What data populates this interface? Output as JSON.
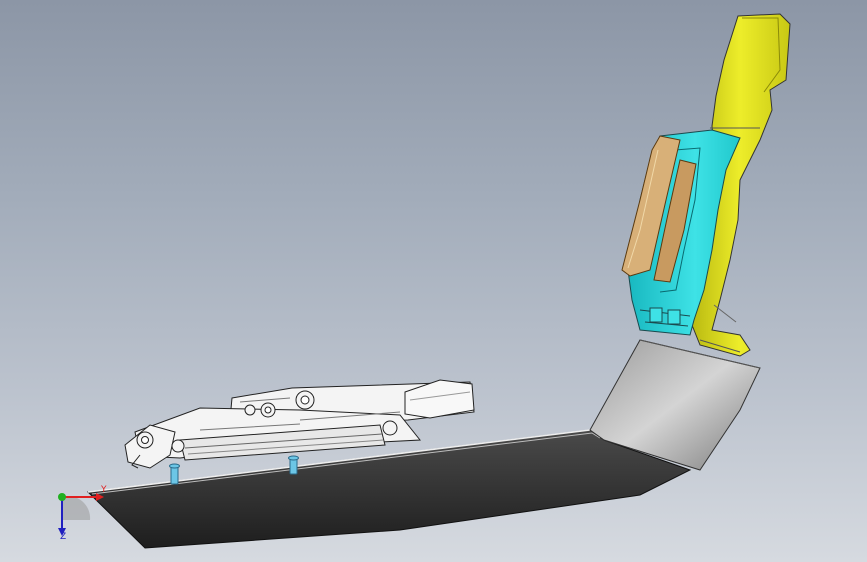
{
  "viewport": {
    "background_top": "#8c96a6",
    "background_bottom": "#d6dae0"
  },
  "triad": {
    "x_axis": {
      "label": "Y",
      "color": "#e02020"
    },
    "y_axis": {
      "label": "",
      "color": "#20b020"
    },
    "z_axis": {
      "label": "Z",
      "color": "#2020c0"
    }
  },
  "model": {
    "parts": [
      {
        "name": "base-plate",
        "color": "#2e2e2e"
      },
      {
        "name": "folding-mechanism",
        "color": "#f2f2f2"
      },
      {
        "name": "shell-cyan",
        "color": "#2fd4d8"
      },
      {
        "name": "shell-yellow",
        "color": "#e2e21a"
      },
      {
        "name": "panel-tan",
        "color": "#d8b078"
      }
    ]
  }
}
